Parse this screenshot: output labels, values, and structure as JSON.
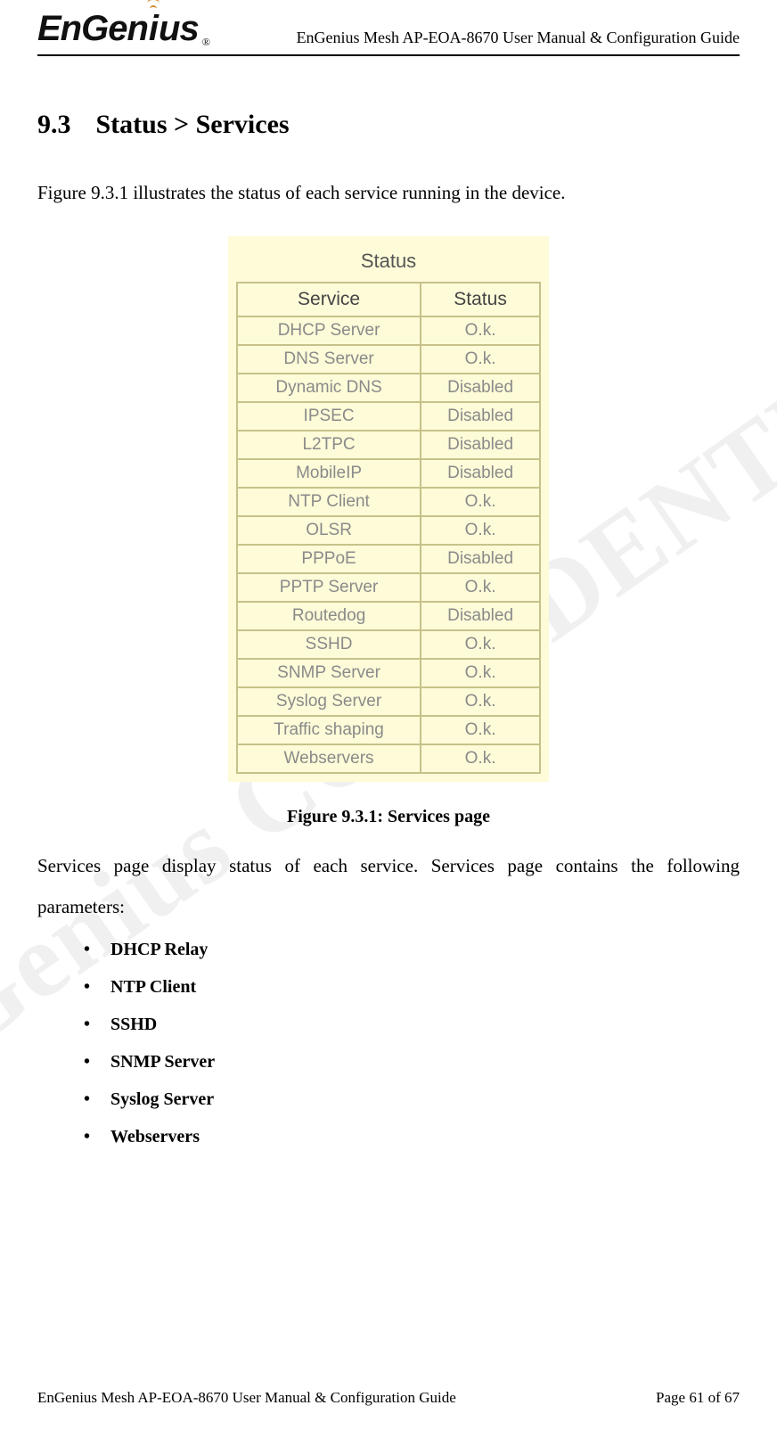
{
  "header": {
    "logo_text": "EnGenius",
    "logo_reg": "®",
    "doc_title": "EnGenius Mesh AP-EOA-8670 User Manual & Configuration Guide"
  },
  "watermark": "EnGenius CONFIDENTIAL",
  "section": {
    "number": "9.3",
    "title": "Status > Services"
  },
  "intro": "Figure 9.3.1 illustrates the status of each service running in the device.",
  "status_panel": {
    "title": "Status",
    "columns": {
      "service": "Service",
      "status": "Status"
    },
    "rows": [
      {
        "service": "DHCP Server",
        "status": "O.k."
      },
      {
        "service": "DNS Server",
        "status": "O.k."
      },
      {
        "service": "Dynamic DNS",
        "status": "Disabled"
      },
      {
        "service": "IPSEC",
        "status": "Disabled"
      },
      {
        "service": "L2TPC",
        "status": "Disabled"
      },
      {
        "service": "MobileIP",
        "status": "Disabled"
      },
      {
        "service": "NTP Client",
        "status": "O.k."
      },
      {
        "service": "OLSR",
        "status": "O.k."
      },
      {
        "service": "PPPoE",
        "status": "Disabled"
      },
      {
        "service": "PPTP Server",
        "status": "O.k."
      },
      {
        "service": "Routedog",
        "status": "Disabled"
      },
      {
        "service": "SSHD",
        "status": "O.k."
      },
      {
        "service": "SNMP Server",
        "status": "O.k."
      },
      {
        "service": "Syslog Server",
        "status": "O.k."
      },
      {
        "service": "Traffic shaping",
        "status": "O.k."
      },
      {
        "service": "Webservers",
        "status": "O.k."
      }
    ]
  },
  "caption": "Figure 9.3.1: Services page",
  "description": "Services page display status of each service. Services page contains the following parameters:",
  "parameters": [
    "DHCP Relay",
    "NTP Client",
    "SSHD",
    "SNMP Server",
    "Syslog Server",
    "Webservers"
  ],
  "footer": {
    "left": "EnGenius Mesh AP-EOA-8670 User Manual & Configuration Guide",
    "right": "Page 61 of 67"
  }
}
